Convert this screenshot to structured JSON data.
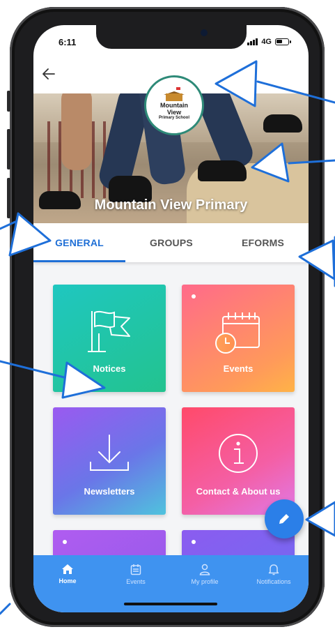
{
  "status_bar": {
    "time": "6:11",
    "network": "4G"
  },
  "school": {
    "name": "Mountain View Primary",
    "logo_lines": [
      "Mountain",
      "View",
      "Primary School"
    ]
  },
  "tabs": [
    {
      "label": "GENERAL",
      "active": true
    },
    {
      "label": "GROUPS",
      "active": false
    },
    {
      "label": "EFORMS",
      "active": false
    }
  ],
  "tiles": [
    {
      "label": "Notices",
      "icon": "flag-icon"
    },
    {
      "label": "Events",
      "icon": "calendar-clock-icon"
    },
    {
      "label": "Newsletters",
      "icon": "download-icon"
    },
    {
      "label": "Contact & About us",
      "icon": "info-icon"
    }
  ],
  "fab": {
    "icon": "pencil-icon"
  },
  "bottom_nav": [
    {
      "label": "Home",
      "icon": "home-icon",
      "active": true
    },
    {
      "label": "Events",
      "icon": "calendar-icon",
      "active": false
    },
    {
      "label": "My profile",
      "icon": "user-icon",
      "active": false
    },
    {
      "label": "Notifications",
      "icon": "bell-icon",
      "active": false
    }
  ],
  "colors": {
    "primary": "#1f6fd6",
    "nav_bar": "#3f93f0",
    "fab": "#2b7fe8",
    "annotation_arrow": "#1e6fd9"
  }
}
